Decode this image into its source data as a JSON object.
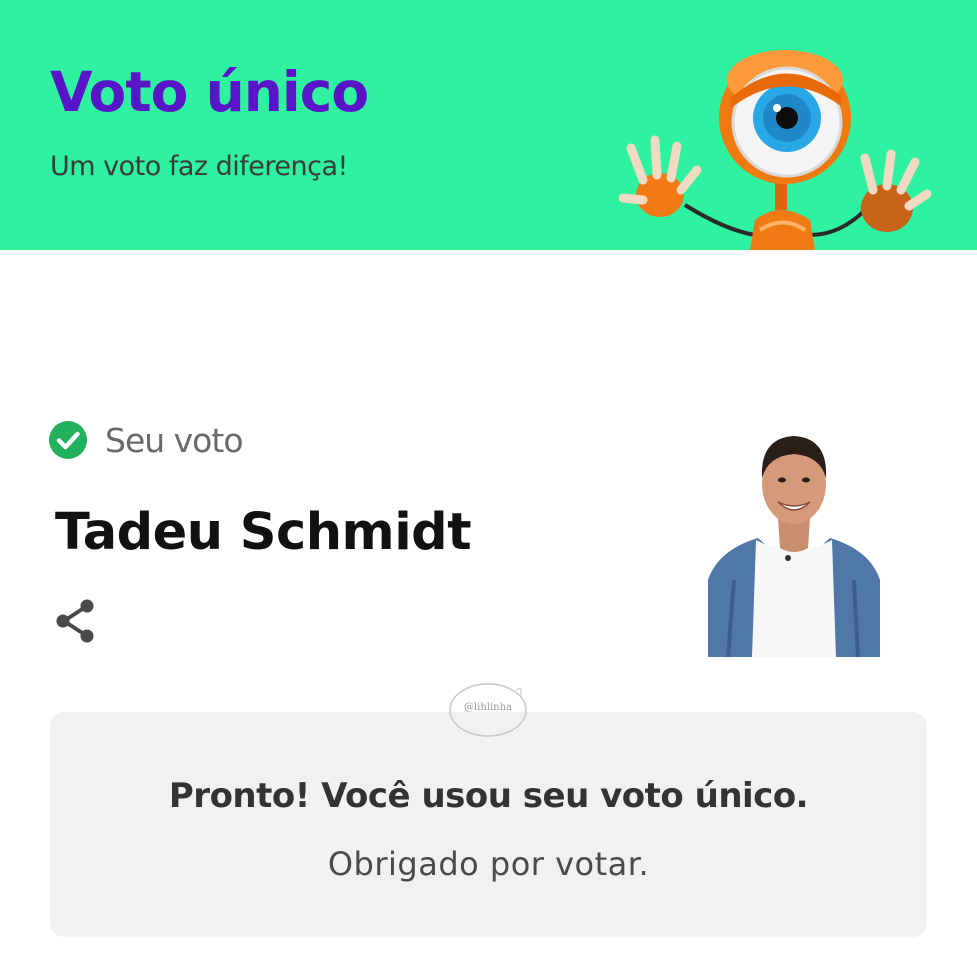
{
  "header": {
    "title": "Voto único",
    "subtitle": "Um voto faz diferença!",
    "background_color": "#2ef2a0",
    "title_color": "#5a14c8",
    "mascot_icon": "bbb-eye-robot-mascot"
  },
  "vote": {
    "status_icon": "check-circle-icon",
    "status_color": "#21b05b",
    "status_label": "Seu voto",
    "candidate_name": "Tadeu Schmidt",
    "share_icon": "share-icon",
    "photo": "candidate-photo"
  },
  "confirmation": {
    "title": "Pronto! Você usou seu voto único.",
    "subtitle": "Obrigado por votar.",
    "background_color": "#f1f1f1"
  },
  "watermark": {
    "text": "@lihlinha"
  }
}
